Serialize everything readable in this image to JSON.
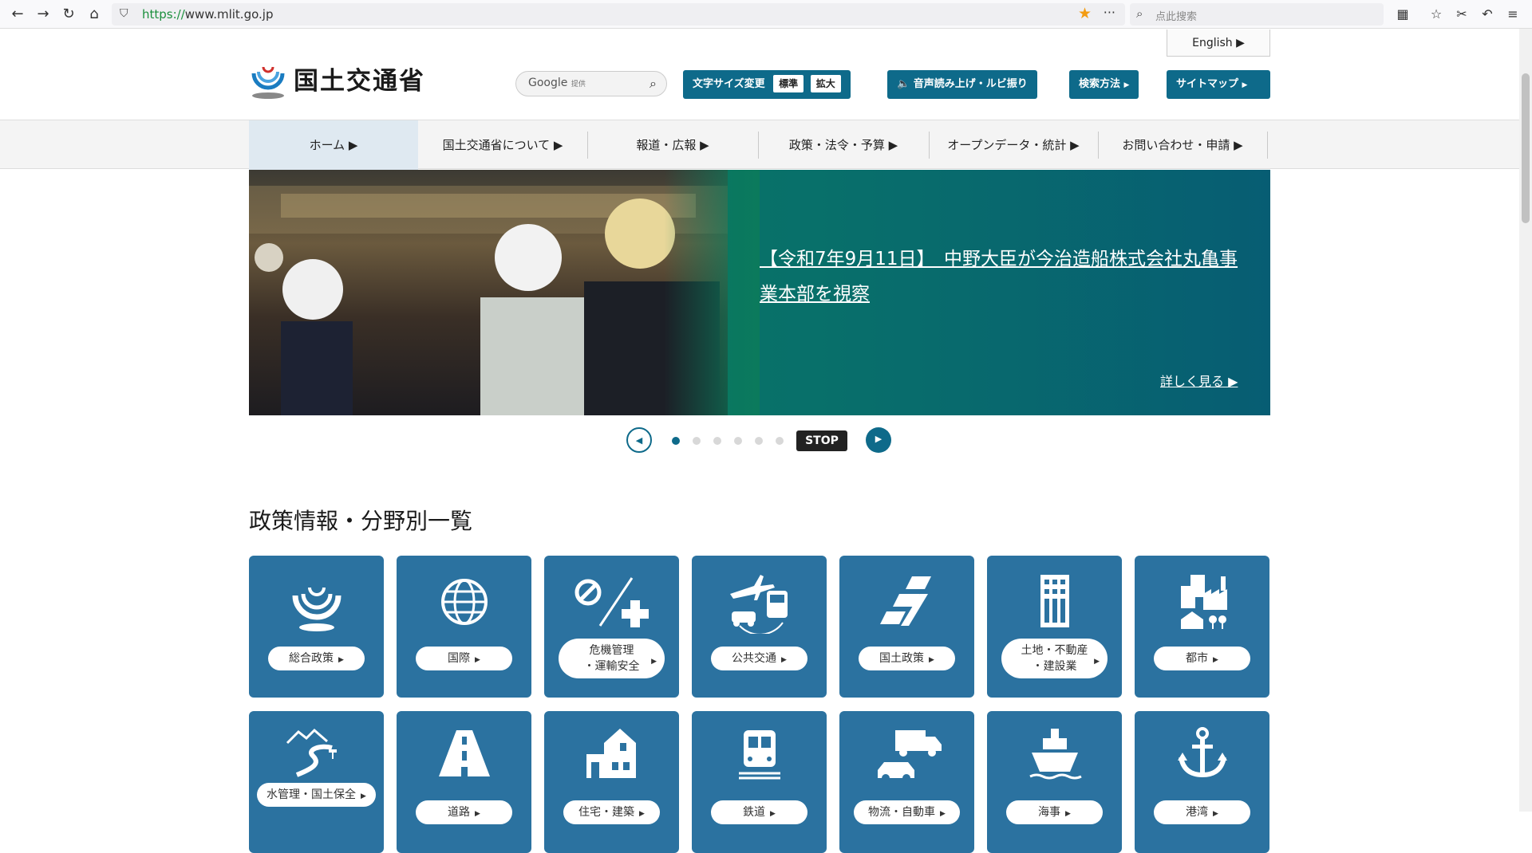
{
  "browser": {
    "url_scheme": "https://",
    "url_host": "www.mlit.go.jp",
    "search_placeholder": "点此搜索"
  },
  "header": {
    "english_label": "English ▶",
    "logo_text": "国土交通省",
    "google_label": "Google",
    "google_suffix": "提供",
    "font_size_label": "文字サイズ変更",
    "font_size_standard": "標準",
    "font_size_large": "拡大",
    "speech_label": "音声読み上げ・ルビ振り",
    "search_method_label": "検索方法",
    "sitemap_label": "サイトマップ"
  },
  "nav": {
    "items": [
      {
        "label": "ホーム ▶"
      },
      {
        "label": "国土交通省について ▶"
      },
      {
        "label": "報道・広報 ▶"
      },
      {
        "label": "政策・法令・予算 ▶"
      },
      {
        "label": "オープンデータ・統計 ▶"
      },
      {
        "label": "お問い合わせ・申請 ▶"
      }
    ]
  },
  "hero": {
    "headline": "【令和7年9月11日】　中野大臣が今治造船株式会社丸亀事業本部を視察",
    "more_label": "詳しく見る ▶",
    "stop_label": "STOP",
    "active_slide": 1,
    "slide_count": 6
  },
  "section": {
    "title": "政策情報・分野別一覧"
  },
  "tiles": [
    {
      "label": "総合政策",
      "icon": "mlit-logo-icon"
    },
    {
      "label": "国際",
      "icon": "globe-icon"
    },
    {
      "label": "危機管理\n・運輸安全",
      "icon": "safety-cross-icon"
    },
    {
      "label": "公共交通",
      "icon": "transport-icon"
    },
    {
      "label": "国土政策",
      "icon": "land-policy-icon"
    },
    {
      "label": "土地・不動産\n・建設業",
      "icon": "building-icon"
    },
    {
      "label": "都市",
      "icon": "city-icon"
    },
    {
      "label": "水管理・国土保全",
      "icon": "river-icon"
    },
    {
      "label": "道路",
      "icon": "road-icon"
    },
    {
      "label": "住宅・建築",
      "icon": "house-icon"
    },
    {
      "label": "鉄道",
      "icon": "train-icon"
    },
    {
      "label": "物流・自動車",
      "icon": "truck-icon"
    },
    {
      "label": "海事",
      "icon": "ship-icon"
    },
    {
      "label": "港湾",
      "icon": "anchor-icon"
    }
  ]
}
